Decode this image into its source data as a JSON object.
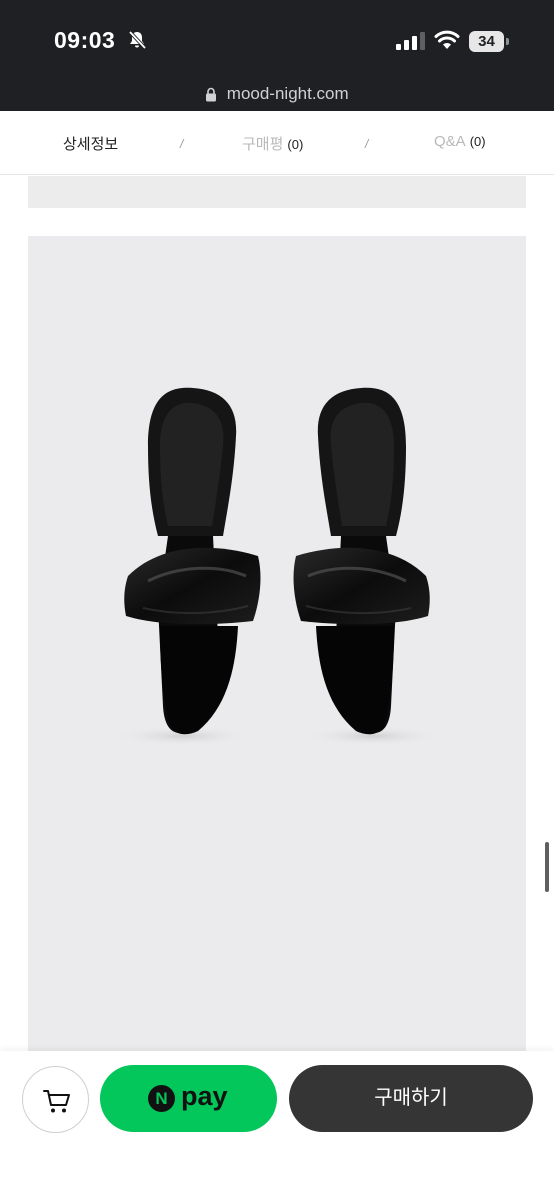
{
  "status_bar": {
    "time": "09:03",
    "battery": "34",
    "icons": [
      "bell-slash-icon",
      "signal-icon",
      "wifi-icon",
      "battery-icon"
    ]
  },
  "url_bar": {
    "url": "mood-night.com",
    "icon": "lock-icon"
  },
  "tabs": [
    {
      "label": "상세정보",
      "count": ""
    },
    {
      "label": "구매평",
      "count": "(0)"
    },
    {
      "label": "Q&A",
      "count": "(0)"
    }
  ],
  "tab_separator": "/",
  "product": {
    "image": "black-patent-mule-sandals"
  },
  "bottom_bar": {
    "cart_icon": "cart-icon",
    "npay_badge": "N",
    "npay_label": "pay",
    "buy_label": "구매하기"
  },
  "colors": {
    "top_bar": "#1e2023",
    "npay_green": "#03c75a",
    "buy_button": "#353535",
    "product_bg": "#ebebed"
  }
}
